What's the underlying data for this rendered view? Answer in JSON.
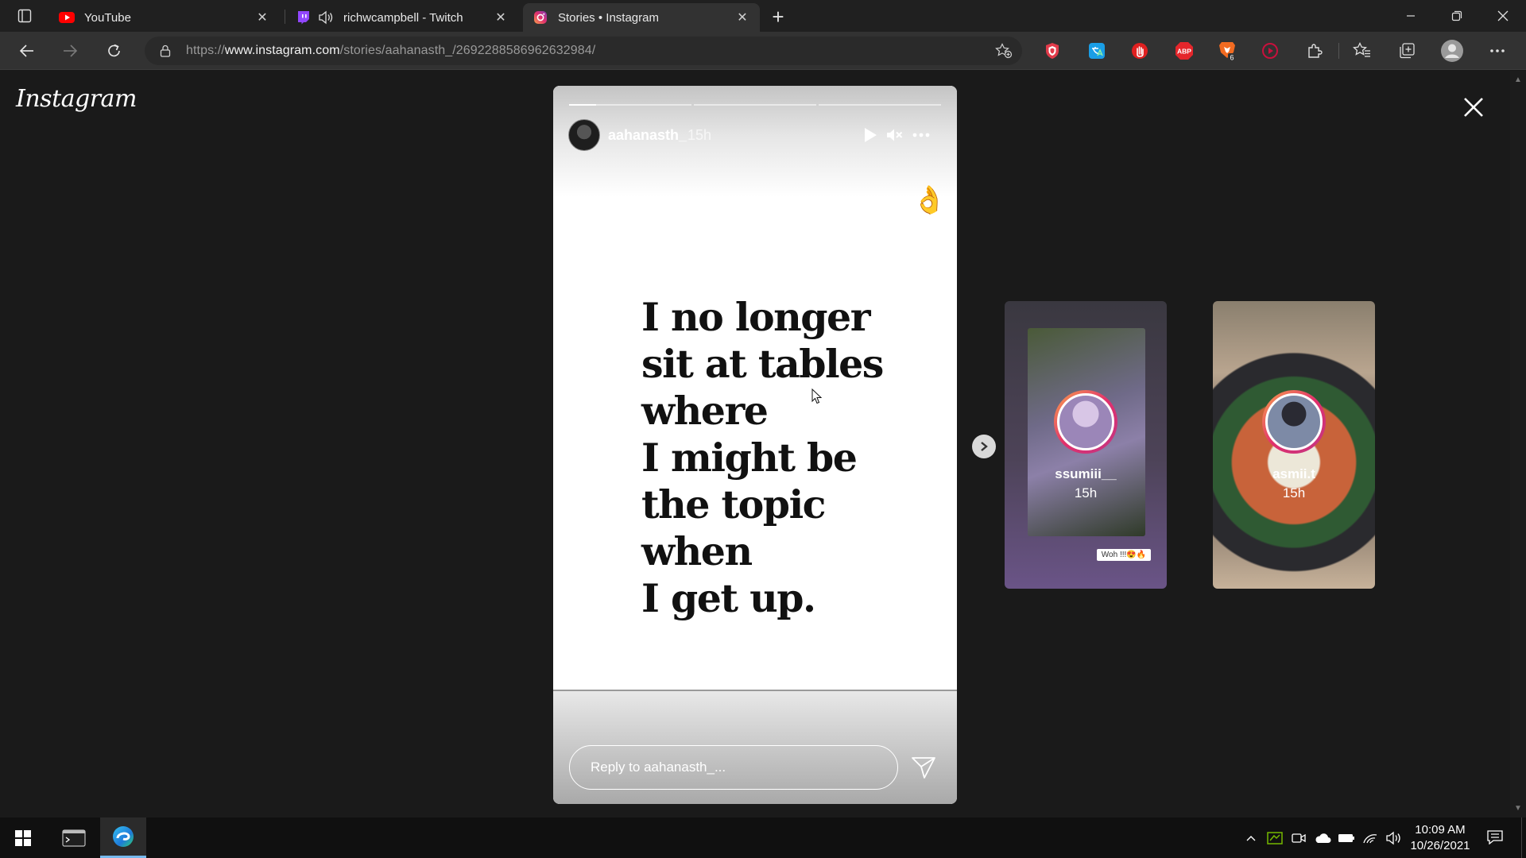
{
  "browser": {
    "tabs": [
      {
        "title": "YouTube",
        "icon": "youtube-icon",
        "color": "#ff0000"
      },
      {
        "title": "richwcampbell - Twitch",
        "icon": "twitch-icon",
        "color": "#9146ff",
        "audio": "speaker-icon"
      },
      {
        "title": "Stories • Instagram",
        "icon": "instagram-icon",
        "color": "#c13584",
        "active": true
      }
    ],
    "address": {
      "prefix": "https://",
      "domain": "www.instagram.com",
      "path": "/stories/aahanasth_/2692288586962632984/"
    },
    "extensions": [
      "shield-icon",
      "translate-icon",
      "hand-stop-icon",
      "abp-icon",
      "brave-icon",
      "media-icon",
      "puzzle-icon",
      "favorites-icon",
      "collections-icon",
      "profile-icon",
      "more-icon"
    ],
    "extension_badge": "6",
    "abp_label": "ABP"
  },
  "instagram": {
    "logo": "Instagram",
    "story": {
      "username": "aahanasth_",
      "time": "15h",
      "emoji": "👌",
      "quote_lines": [
        "I no longer",
        "sit at tables",
        "where",
        "I might be",
        "the topic",
        "when",
        "I get up."
      ],
      "reply_placeholder": "Reply to aahanasth_..."
    },
    "previews": [
      {
        "username": "ssumiii__",
        "time": "15h",
        "sticker": "Woh !!!😍🔥"
      },
      {
        "username": "asmii.t",
        "time": "15h"
      }
    ]
  },
  "taskbar": {
    "time": "10:09 AM",
    "date": "10/26/2021"
  }
}
